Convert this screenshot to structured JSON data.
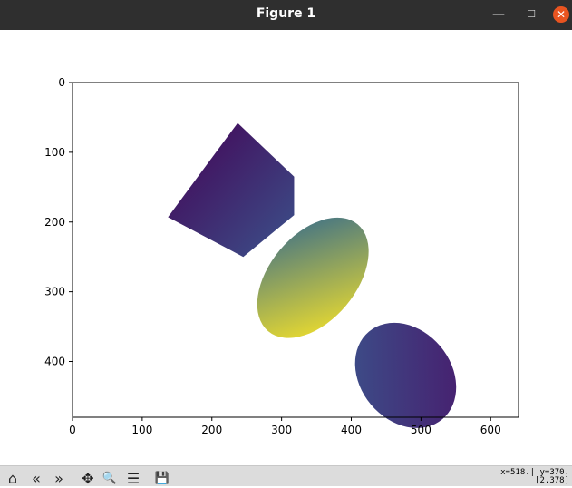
{
  "window": {
    "title": "Figure 1",
    "minimize_glyph": "—",
    "maximize_glyph": "☐",
    "close_glyph": "✕"
  },
  "toolbar": {
    "buttons": [
      {
        "name": "home-icon",
        "glyph": "⌂"
      },
      {
        "name": "back-icon",
        "glyph": "«"
      },
      {
        "name": "forward-icon",
        "glyph": "»"
      },
      {
        "name": "pan-icon",
        "glyph": "✥"
      },
      {
        "name": "zoom-icon",
        "glyph": "🔍"
      },
      {
        "name": "configure-subplots-icon",
        "glyph": "☰"
      },
      {
        "name": "save-icon",
        "glyph": "💾"
      }
    ],
    "coords_line1": "x=518.| y=370.",
    "coords_line2": "[2.378]"
  },
  "chart_data": {
    "type": "heatmap",
    "colormap": "viridis",
    "xlim": [
      0,
      640
    ],
    "ylim": [
      480,
      0
    ],
    "xticks": [
      "0",
      "100",
      "200",
      "300",
      "400",
      "500",
      "600"
    ],
    "yticks": [
      "0",
      "100",
      "200",
      "300",
      "400"
    ],
    "grid": false,
    "regions": [
      {
        "shape": "polygon",
        "points": [
          [
            237,
            58
          ],
          [
            318,
            135
          ],
          [
            318,
            190
          ],
          [
            245,
            250
          ],
          [
            137,
            193
          ]
        ],
        "color_low": "#440154",
        "color_high": "#3b528b"
      },
      {
        "shape": "ellipse",
        "cx": 345,
        "cy": 280,
        "rx": 62,
        "ry": 100,
        "rotation": 40,
        "color_low": "#31688e",
        "color_high": "#fde725"
      },
      {
        "shape": "ellipse",
        "cx": 478,
        "cy": 420,
        "rx": 65,
        "ry": 82,
        "rotation": -40,
        "color_low": "#3b528b",
        "color_high": "#481a6c"
      }
    ]
  }
}
